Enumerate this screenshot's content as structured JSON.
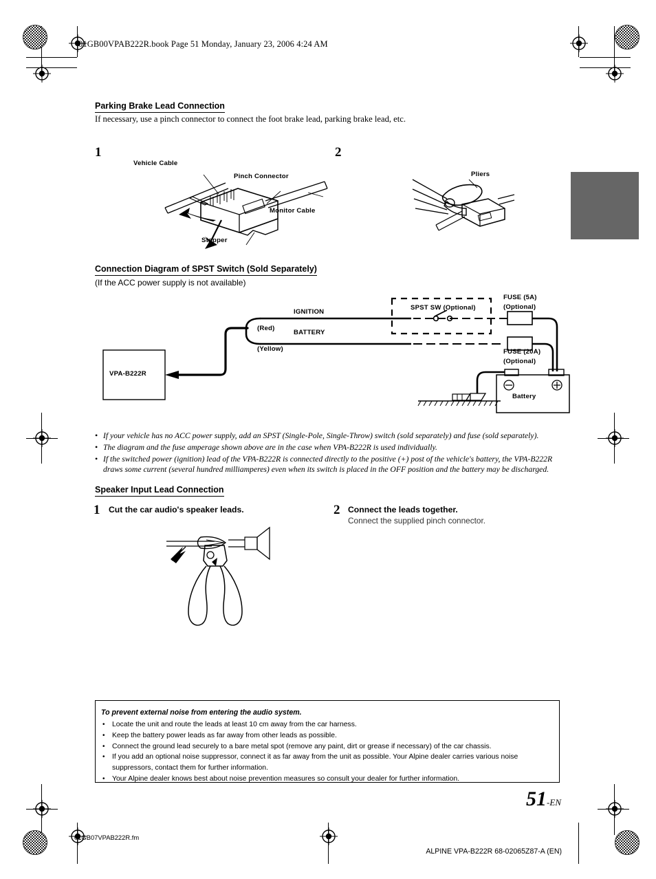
{
  "header": {
    "book_line": "01GB00VPAB222R.book  Page 51  Monday, January 23, 2006  4:24 AM"
  },
  "section_parking": {
    "heading": "Parking Brake Lead Connection",
    "intro": "If necessary, use a pinch connector to connect the foot brake lead, parking brake lead, etc.",
    "step1_num": "1",
    "step2_num": "2",
    "labels": {
      "vehicle_cable": "Vehicle Cable",
      "pinch_connector": "Pinch Connector",
      "monitor_cable": "Monitor Cable",
      "stopper": "Stopper",
      "pliers": "Pliers"
    }
  },
  "section_spst": {
    "heading": "Connection Diagram of SPST Switch (Sold Separately)",
    "subheading": "(If the ACC power supply is not available)",
    "diagram": {
      "unit": "VPA-B222R",
      "ignition": "IGNITION",
      "battery_lead": "BATTERY",
      "red": "(Red)",
      "yellow": "(Yellow)",
      "spst_sw": "SPST SW (Optional)",
      "fuse5": "FUSE (5A)",
      "fuse5_opt": "(Optional)",
      "fuse20": "FUSE (20A)",
      "fuse20_opt": "(Optional)",
      "battery": "Battery",
      "terminal_negative": "⊖",
      "terminal_positive": "⊕"
    },
    "notes": [
      "If your vehicle has no ACC power supply, add an SPST (Single-Pole, Single-Throw) switch (sold separately) and fuse (sold separately).",
      "The diagram and the fuse amperage shown above are in the case when VPA-B222R is used individually.",
      "If the switched power (ignition) lead of the VPA-B222R is connected directly to the positive (+) post of the vehicle's battery, the VPA-B222R draws some current (several hundred milliamperes) even when its switch is placed in the OFF position and the battery may be discharged."
    ]
  },
  "section_speaker": {
    "heading": "Speaker Input Lead Connection",
    "step1_num": "1",
    "step1_title": "Cut the car audio's speaker leads.",
    "step2_num": "2",
    "step2_title": "Connect the leads together.",
    "step2_desc": "Connect the supplied pinch connector."
  },
  "noise_box": {
    "title": "To prevent external noise from entering the audio system.",
    "items": [
      "Locate the unit and route the leads at least 10 cm away from the car harness.",
      "Keep the battery power leads as far away from other leads as possible.",
      "Connect the ground lead securely to a bare metal spot (remove any paint, dirt or grease if necessary) of the car chassis.",
      "If you add an optional noise suppressor, connect it as far away from the unit as possible. Your Alpine dealer carries various noise suppressors, contact them for further information.",
      "Your Alpine dealer knows best about noise prevention measures so consult your dealer for further information."
    ]
  },
  "footer": {
    "page_number": "51",
    "page_suffix": "-EN",
    "fm_name": "01GB07VPAB222R.fm",
    "imprint": "ALPINE VPA-B222R 68-02065Z87-A (EN)"
  },
  "colors": {
    "thumb_tab": "#666666",
    "rule": "#000000"
  }
}
